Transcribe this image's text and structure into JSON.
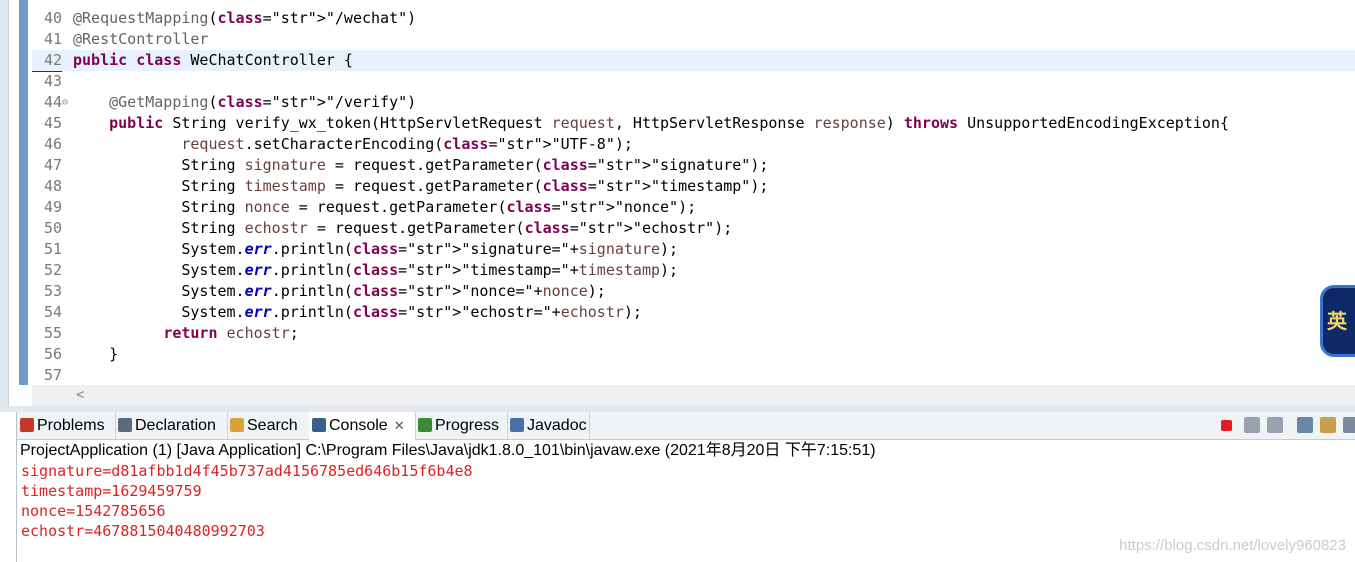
{
  "editor": {
    "lines": [
      {
        "n": "40",
        "type": "ann",
        "text": "@RequestMapping(\"/wechat\")"
      },
      {
        "n": "41",
        "type": "ann2",
        "text": "@RestController"
      },
      {
        "n": "42",
        "type": "classdecl",
        "text": "public class WeChatController {"
      },
      {
        "n": "43",
        "type": "blank",
        "text": ""
      },
      {
        "n": "44",
        "type": "getmapping",
        "text": "@GetMapping(\"/verify\")"
      },
      {
        "n": "45",
        "type": "method",
        "text": "public String verify_wx_token(HttpServletRequest request, HttpServletResponse response) throws UnsupportedEncodingException{"
      },
      {
        "n": "46",
        "type": "setenc",
        "text": "request.setCharacterEncoding(\"UTF-8\");"
      },
      {
        "n": "47",
        "type": "param",
        "text": "String signature = request.getParameter(\"signature\");"
      },
      {
        "n": "48",
        "type": "param",
        "text": "String timestamp = request.getParameter(\"timestamp\");"
      },
      {
        "n": "49",
        "type": "param",
        "text": "String nonce = request.getParameter(\"nonce\");"
      },
      {
        "n": "50",
        "type": "param",
        "text": "String echostr = request.getParameter(\"echostr\");"
      },
      {
        "n": "51",
        "type": "println",
        "text": "System.err.println(\"signature=\"+signature);"
      },
      {
        "n": "52",
        "type": "println",
        "text": "System.err.println(\"timestamp=\"+timestamp);"
      },
      {
        "n": "53",
        "type": "println",
        "text": "System.err.println(\"nonce=\"+nonce);"
      },
      {
        "n": "54",
        "type": "println",
        "text": "System.err.println(\"echostr=\"+echostr);"
      },
      {
        "n": "55",
        "type": "return",
        "text": "return echostr;"
      },
      {
        "n": "56",
        "type": "close",
        "text": "}"
      },
      {
        "n": "57",
        "type": "blank",
        "text": ""
      }
    ],
    "scroll_left_arrow": "<",
    "ime_badge": "英"
  },
  "tabs": [
    {
      "label": "Problems",
      "icon": "problems-icon",
      "color": "#c0392b"
    },
    {
      "label": "Declaration",
      "icon": "declaration-icon",
      "color": "#5b6b7b"
    },
    {
      "label": "Search",
      "icon": "search-icon",
      "color": "#d9a33a"
    },
    {
      "label": "Console",
      "icon": "console-icon",
      "color": "#3b5f8a",
      "active": true,
      "closable": true
    },
    {
      "label": "Progress",
      "icon": "progress-icon",
      "color": "#3a8a3a"
    },
    {
      "label": "Javadoc",
      "icon": "javadoc-icon",
      "color": "#4a6fa5"
    }
  ],
  "tab_close_glyph": "✕",
  "console": {
    "header": "ProjectApplication (1) [Java Application] C:\\Program Files\\Java\\jdk1.8.0_101\\bin\\javaw.exe (2021年8月20日 下午7:15:51)",
    "output": [
      "signature=d81afbb1d4f45b737ad4156785ed646b15f6b4e8",
      "timestamp=1629459759",
      "nonce=1542785656",
      "echostr=4678815040480992703"
    ],
    "output_color": "#dd2222"
  },
  "watermark": "https://blog.csdn.net/lovely960823"
}
